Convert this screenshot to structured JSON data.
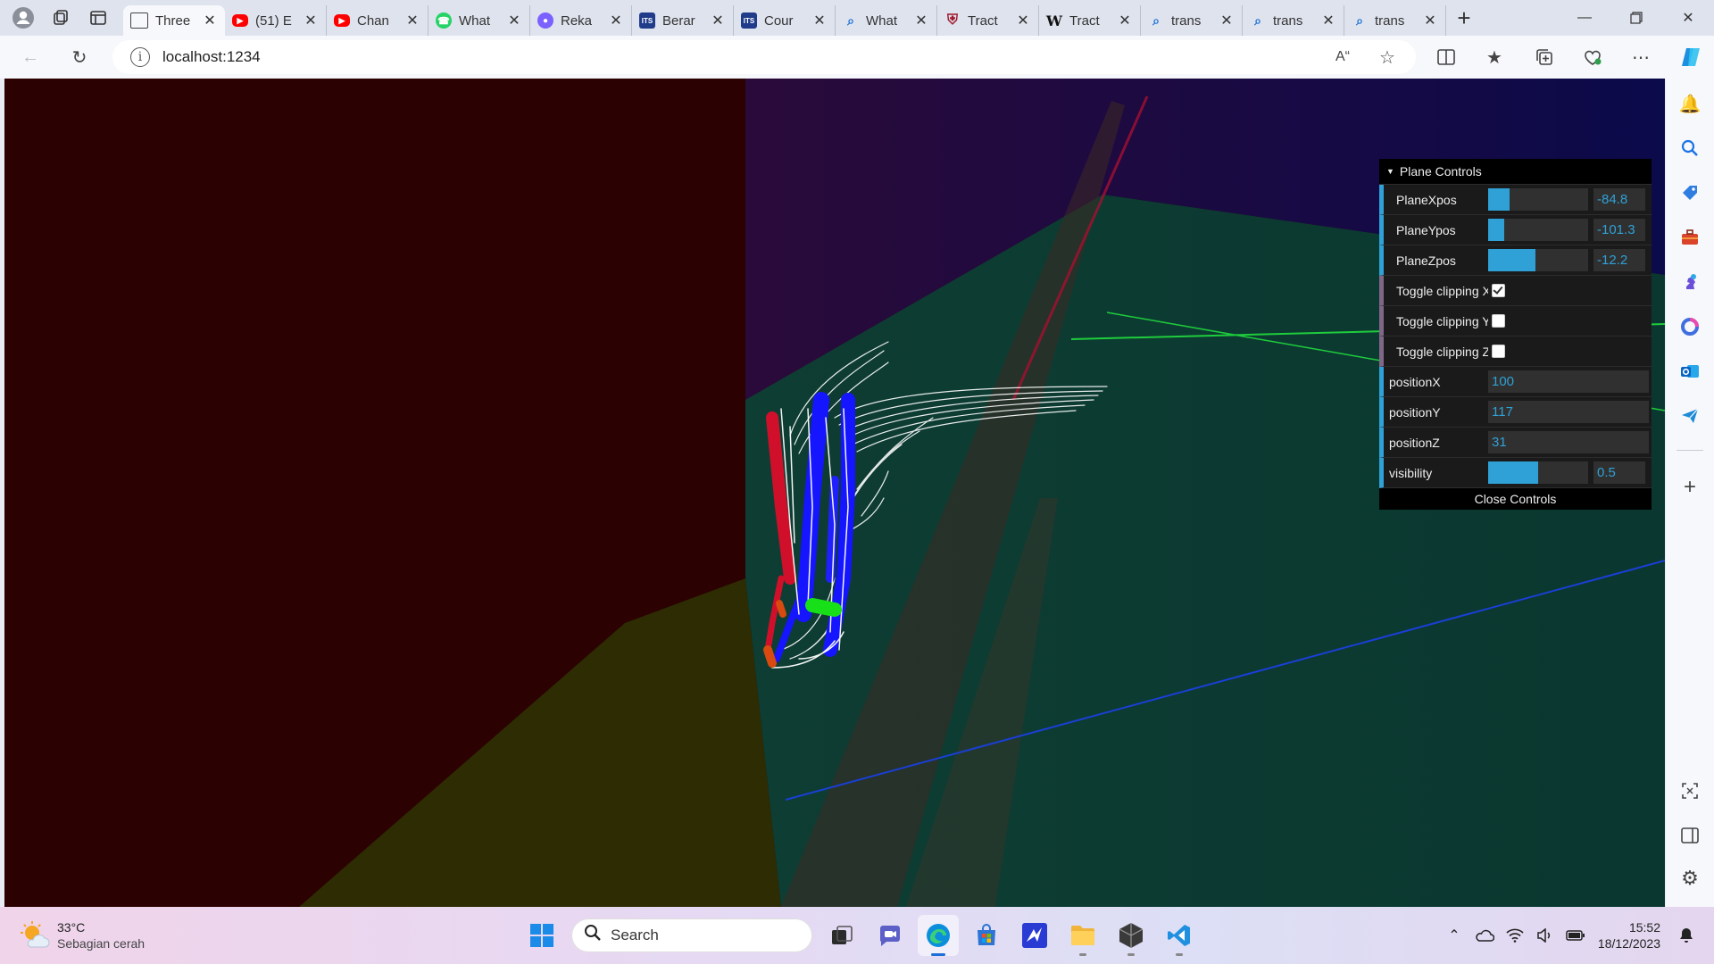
{
  "browser": {
    "tabs": [
      {
        "label": "Three",
        "icon": "page-icon",
        "color": "#444444",
        "active": true
      },
      {
        "label": "(51) E",
        "icon": "youtube-icon",
        "color": "#ff0000",
        "active": false
      },
      {
        "label": "Chan",
        "icon": "youtube-icon",
        "color": "#ff0000",
        "active": false
      },
      {
        "label": "What",
        "icon": "whatsapp-icon",
        "color": "#25d366",
        "active": false
      },
      {
        "label": "Reka",
        "icon": "recording-icon",
        "color": "#7b61ff",
        "active": false
      },
      {
        "label": "Berar",
        "icon": "its-icon",
        "color": "#1f3b8a",
        "active": false
      },
      {
        "label": "Cour",
        "icon": "its-icon",
        "color": "#1f3b8a",
        "active": false
      },
      {
        "label": "What",
        "icon": "search-icon",
        "color": "#1a6fd6",
        "active": false
      },
      {
        "label": "Tract",
        "icon": "shield-icon",
        "color": "#a0182b",
        "active": false
      },
      {
        "label": "Tract",
        "icon": "wikipedia-icon",
        "color": "#111111",
        "active": false
      },
      {
        "label": "trans",
        "icon": "search-icon",
        "color": "#1a6fd6",
        "active": false
      },
      {
        "label": "trans",
        "icon": "search-icon",
        "color": "#1a6fd6",
        "active": false
      },
      {
        "label": "trans",
        "icon": "search-icon",
        "color": "#1a6fd6",
        "active": false
      }
    ],
    "url": "localhost:1234"
  },
  "gui": {
    "folder_title": "Plane Controls",
    "sliders": [
      {
        "label": "PlaneXpos",
        "value": "-84.8",
        "fill_fraction": 0.21
      },
      {
        "label": "PlaneYpos",
        "value": "-101.3",
        "fill_fraction": 0.16
      },
      {
        "label": "PlaneZpos",
        "value": "-12.2",
        "fill_fraction": 0.47
      }
    ],
    "toggles": [
      {
        "label": "Toggle clipping X",
        "checked": true
      },
      {
        "label": "Toggle clipping Y",
        "checked": false
      },
      {
        "label": "Toggle clipping Z",
        "checked": false
      }
    ],
    "positions": [
      {
        "label": "positionX",
        "value": "100"
      },
      {
        "label": "positionY",
        "value": "117"
      },
      {
        "label": "positionZ",
        "value": "31"
      }
    ],
    "visibility": {
      "label": "visibility",
      "value": "0.5",
      "fill_fraction": 0.5
    },
    "close_label": "Close Controls",
    "accent": "#2fa1d6"
  },
  "taskbar": {
    "weather_temp": "33°C",
    "weather_desc": "Sebagian cerah",
    "search_label": "Search",
    "time": "15:52",
    "date": "18/12/2023"
  }
}
